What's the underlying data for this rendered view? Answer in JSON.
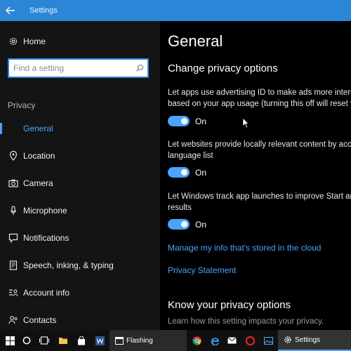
{
  "window": {
    "title": "Settings"
  },
  "sidebar": {
    "home_label": "Home",
    "search_placeholder": "Find a setting",
    "section_label": "Privacy",
    "items": [
      {
        "label": "General",
        "icon": "shield-icon",
        "active": true
      },
      {
        "label": "Location",
        "icon": "location-pin-icon"
      },
      {
        "label": "Camera",
        "icon": "camera-icon"
      },
      {
        "label": "Microphone",
        "icon": "microphone-icon"
      },
      {
        "label": "Notifications",
        "icon": "notification-icon"
      },
      {
        "label": "Speech, inking, & typing",
        "icon": "speech-icon"
      },
      {
        "label": "Account info",
        "icon": "account-info-icon"
      },
      {
        "label": "Contacts",
        "icon": "contacts-icon"
      }
    ]
  },
  "main": {
    "title": "General",
    "section_title": "Change privacy options",
    "options": [
      {
        "line1": "Let apps use advertising ID to make ads more interesting to you",
        "line2": "based on your app usage (turning this off will reset your ID)",
        "state": "On"
      },
      {
        "line1": "Let websites provide locally relevant content by accessing my",
        "line2": "language list",
        "state": "On"
      },
      {
        "line1": "Let Windows track app launches to improve Start and search",
        "line2": "results",
        "state": "On"
      }
    ],
    "link_manage": "Manage my info that's stored in the cloud",
    "link_privacy": "Privacy Statement",
    "section_title_2": "Know your privacy options",
    "section_desc_2": "Learn how this setting impacts your privacy."
  },
  "taskbar": {
    "apps": [
      {
        "label": "Flashing"
      },
      {
        "label": "Settings"
      }
    ]
  },
  "colors": {
    "accent": "#2b86d8",
    "link": "#4aa3ff",
    "sidebar_bg": "#141414",
    "taskbar_bg": "#101010"
  }
}
